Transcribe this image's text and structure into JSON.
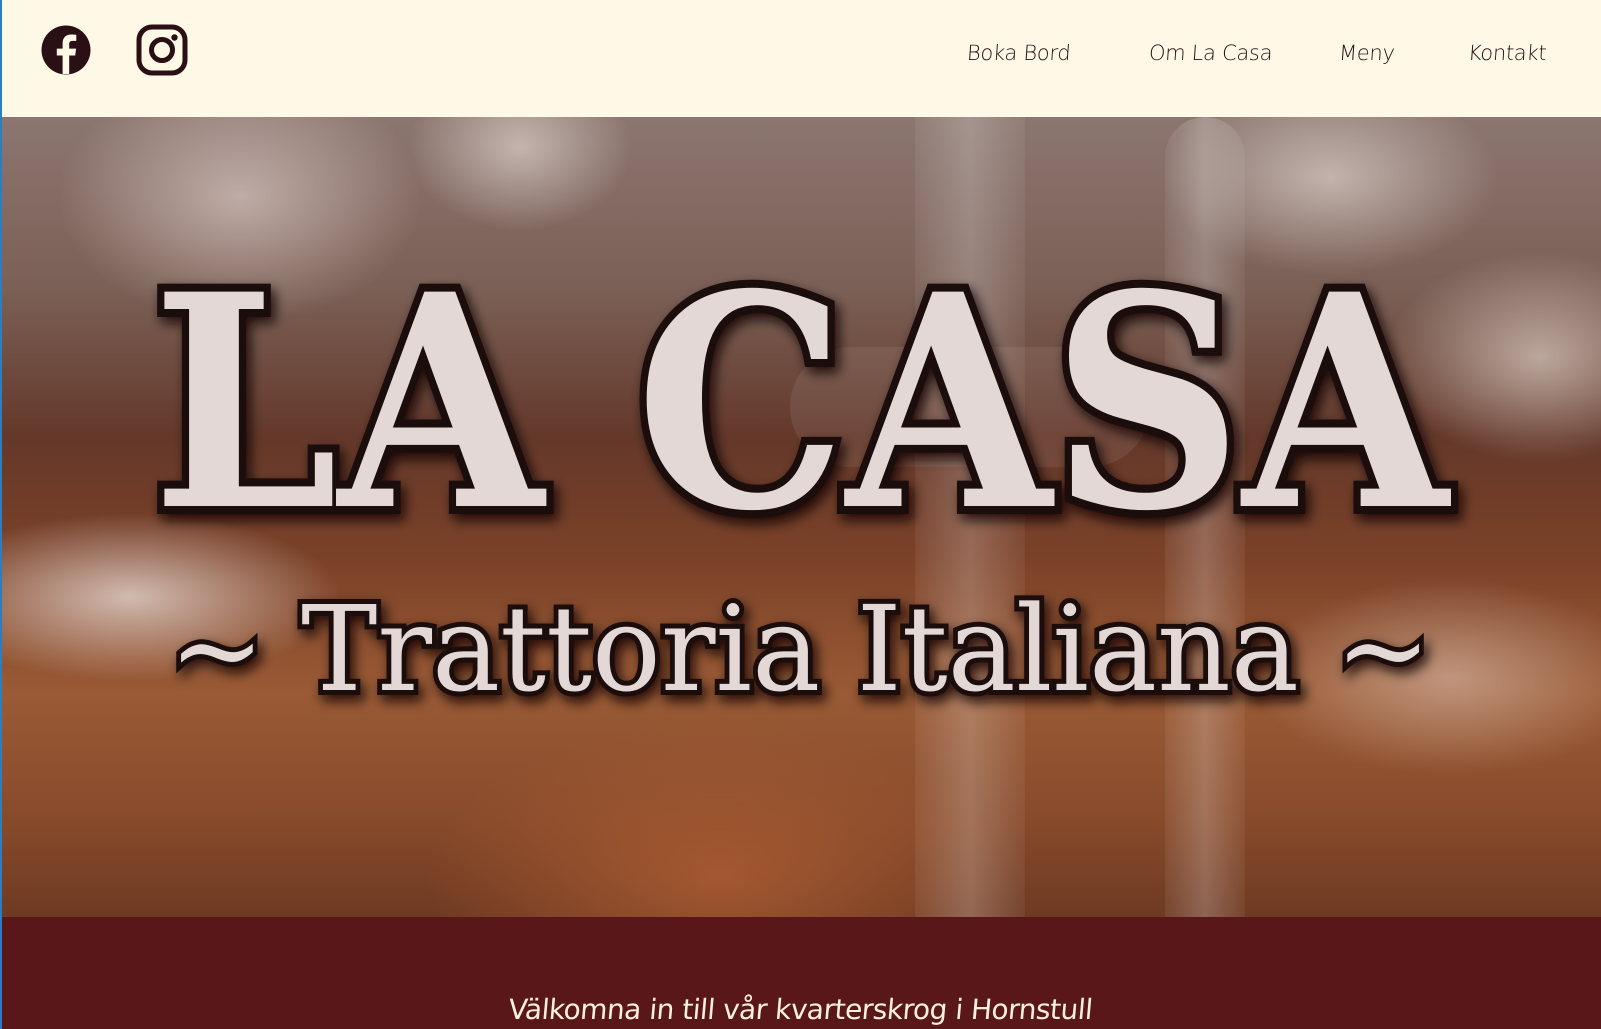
{
  "header": {
    "social": [
      {
        "icon": "facebook-icon"
      },
      {
        "icon": "instagram-icon"
      }
    ],
    "nav": [
      {
        "label": "Boka Bord"
      },
      {
        "label": "Om La Casa"
      },
      {
        "label": "Meny"
      },
      {
        "label": "Kontakt"
      }
    ]
  },
  "hero": {
    "title": "LA CASA",
    "subtitle": "~ Trattoria Italiana ~"
  },
  "welcome": {
    "text": "Välkomna in till vår kvarterskrog i Hornstull"
  },
  "colors": {
    "header_bg": "#fef8e7",
    "nav_text": "#2a0f14",
    "icon": "#2a0f14",
    "band_bg": "#5a1719",
    "band_text": "#fdf1dc",
    "hero_text_fill": "#e4d8d6",
    "hero_text_stroke": "#1a0b0b"
  }
}
